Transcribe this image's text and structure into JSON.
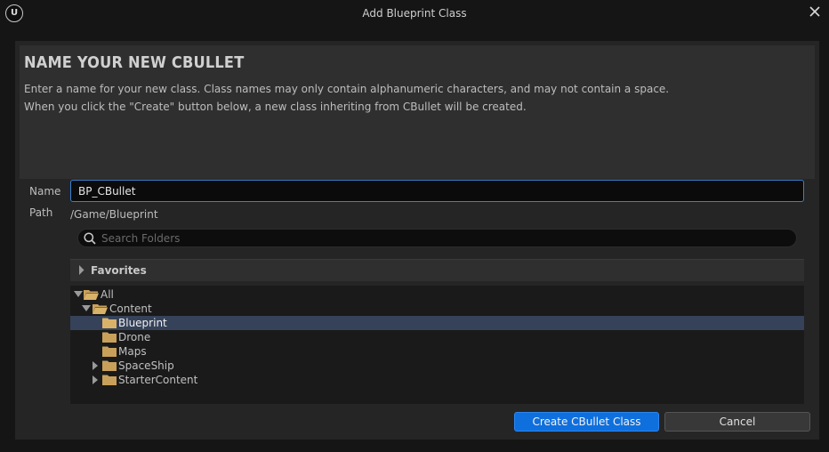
{
  "window": {
    "title": "Add Blueprint Class",
    "logo": "U"
  },
  "header": {
    "heading": "NAME YOUR NEW CBULLET",
    "line1": "Enter a name for your new class. Class names may only contain alphanumeric characters, and may not contain a space.",
    "line2": "When you click the \"Create\" button below, a new class inheriting from CBullet will be created."
  },
  "form": {
    "name_label": "Name",
    "name_value": "BP_CBullet",
    "path_label": "Path",
    "path_value": "/Game/Blueprint"
  },
  "search": {
    "placeholder": "Search Folders",
    "icon": "search-icon"
  },
  "favorites": {
    "label": "Favorites"
  },
  "tree": [
    {
      "label": "All",
      "state": "expanded",
      "selected": false
    },
    {
      "label": "Content",
      "state": "expanded",
      "selected": false
    },
    {
      "label": "Blueprint",
      "state": "leaf",
      "selected": true
    },
    {
      "label": "Drone",
      "state": "leaf",
      "selected": false
    },
    {
      "label": "Maps",
      "state": "leaf",
      "selected": false
    },
    {
      "label": "SpaceShip",
      "state": "collapsed",
      "selected": false
    },
    {
      "label": "StarterContent",
      "state": "collapsed",
      "selected": false
    }
  ],
  "buttons": {
    "create": "Create CBullet Class",
    "cancel": "Cancel"
  },
  "colors": {
    "accent": "#0F6FDD",
    "selection": "#354259",
    "folder": "#C9A05A",
    "input_focus": "#3A7FD0"
  }
}
